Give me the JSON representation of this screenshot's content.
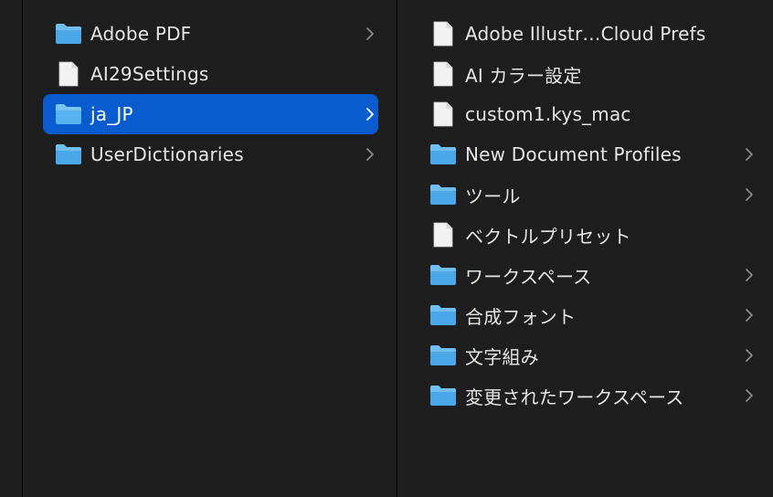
{
  "middle_column": {
    "items": [
      {
        "label": "Adobe PDF",
        "icon": "folder-icon",
        "has_children": true,
        "selected": false
      },
      {
        "label": "AI29Settings",
        "icon": "document-icon",
        "has_children": false,
        "selected": false
      },
      {
        "label": "ja_JP",
        "icon": "folder-icon",
        "has_children": true,
        "selected": true
      },
      {
        "label": "UserDictionaries",
        "icon": "folder-icon",
        "has_children": true,
        "selected": false
      }
    ]
  },
  "right_column": {
    "items": [
      {
        "label": "Adobe Illustr…Cloud Prefs",
        "icon": "document-icon",
        "has_children": false
      },
      {
        "label": "AI カラー設定",
        "icon": "document-icon",
        "has_children": false
      },
      {
        "label": "custom1.kys_mac",
        "icon": "document-icon",
        "has_children": false
      },
      {
        "label": "New Document Profiles",
        "icon": "folder-icon",
        "has_children": true
      },
      {
        "label": "ツール",
        "icon": "folder-icon",
        "has_children": true
      },
      {
        "label": "ベクトルプリセット",
        "icon": "document-icon",
        "has_children": false
      },
      {
        "label": "ワークスペース",
        "icon": "folder-icon",
        "has_children": true
      },
      {
        "label": "合成フォント",
        "icon": "folder-icon",
        "has_children": true
      },
      {
        "label": "文字組み",
        "icon": "folder-icon",
        "has_children": true
      },
      {
        "label": "変更されたワークスペース",
        "icon": "folder-icon",
        "has_children": true
      }
    ]
  },
  "colors": {
    "background": "#1e1e1e",
    "selection": "#0a5ad0",
    "text": "#e6e6e6",
    "folder": "#4aa8e8",
    "chevron": "#8a8a8a"
  }
}
